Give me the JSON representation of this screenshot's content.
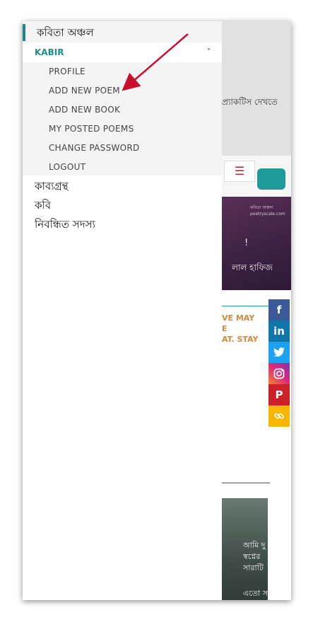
{
  "background": {
    "partial_text": "প্র্যাকটিস দেখতে",
    "menu_icon": "hamburger-icon",
    "banner": {
      "brand": "কবিতা অঞ্চল poetryscale.com",
      "exclaim": "!",
      "name": "লাল হাফিজ"
    },
    "notice_lines": [
      "VE MAY",
      "E",
      "AT. STAY"
    ],
    "photo_lines": [
      "আমি দু",
      "স্বপ্নের",
      "সারাটি",
      "এতো স"
    ]
  },
  "social": [
    {
      "name": "facebook-icon",
      "glyph": "f",
      "color": "#3b5998"
    },
    {
      "name": "linkedin-icon",
      "glyph": "in",
      "color": "#0e76a8"
    },
    {
      "name": "twitter-icon",
      "glyph": "🐦",
      "color": "#1da1f2"
    },
    {
      "name": "instagram-icon",
      "glyph": "◎",
      "color": "#c13584"
    },
    {
      "name": "pinterest-icon",
      "glyph": "P",
      "color": "#cb2027"
    },
    {
      "name": "copy-link-icon",
      "glyph": "∞",
      "color": "#f7b500"
    }
  ],
  "drawer": {
    "title": "কবিতা অঞ্চল",
    "user": "KABIR",
    "chevron": "˅",
    "submenu": [
      "PROFILE",
      "ADD NEW POEM",
      "ADD NEW BOOK",
      "MY POSTED POEMS",
      "CHANGE PASSWORD",
      "LOGOUT"
    ],
    "links": [
      "কাব্যগ্রন্থ",
      "কবি",
      "নিবন্ধিত সদস্য"
    ]
  },
  "colors": {
    "accent": "#1b8c90",
    "arrow": "#c8102e"
  }
}
